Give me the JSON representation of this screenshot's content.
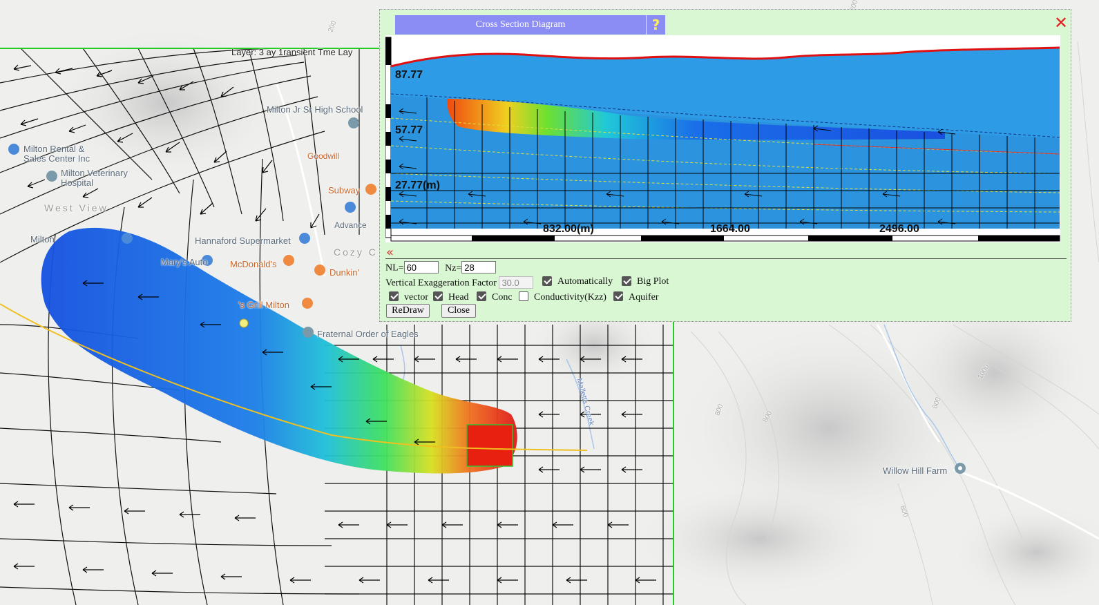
{
  "map": {
    "places": [
      {
        "name": "Milton Rental & Sales Center Inc",
        "line1": "Milton Rental &",
        "line2": "Sales Center Inc"
      },
      {
        "name": "Milton Veterinary Hospital",
        "line1": "Milton Veterinary",
        "line2": "Hospital"
      },
      {
        "name": "Milton Jr Sr High School",
        "line1": "Milton Jr Sr High School"
      },
      {
        "name": "West View",
        "line1": "West View"
      },
      {
        "name": "Milton",
        "line1": "Milton"
      },
      {
        "name": "Hannaford Supermarket",
        "line1": "Hannaford Supermarket"
      },
      {
        "name": "Mary's Auto",
        "line1": "Mary's Auto"
      },
      {
        "name": "McDonald's",
        "line1": "McDonald's"
      },
      {
        "name": "Subway",
        "line1": "Subway"
      },
      {
        "name": "Dunkin'",
        "line1": "Dunkin'"
      },
      {
        "name": "Cozy Corner",
        "line1": "Cozy C"
      },
      {
        "name": "'s Grill Milton",
        "line1": "'s Grill Milton"
      },
      {
        "name": "Fraternal Order of Eagles",
        "line1": "Fraternal Order of Eagles"
      },
      {
        "name": "Willow Hill Farm",
        "line1": "Willow Hill Farm"
      },
      {
        "name": "Malletts Creek",
        "line1": "Malletts Creek"
      },
      {
        "name": "Advance",
        "line1": "Advance"
      },
      {
        "name": "Goodwill",
        "line1": "Goodwill"
      }
    ],
    "contours": [
      "800",
      "800",
      "800",
      "1000",
      "800",
      "200",
      "200"
    ],
    "overlay_title": "Layer: 3 ay 1ransient Tme Lay"
  },
  "dialog": {
    "title": "Cross Section Diagram",
    "help": "?",
    "close": "✕",
    "collapse": "«",
    "nl_label": "NL=",
    "nl_value": "60",
    "nz_label": "Nz=",
    "nz_value": "28",
    "vef_label": "Vertical Exaggeration Factor",
    "vef_value": "30.0",
    "auto_label": "Automatically",
    "bigplot_label": "Big Plot",
    "vector_label": "vector",
    "head_label": "Head",
    "conc_label": "Conc",
    "kzz_label": "Conductivity(Kzz)",
    "aquifer_label": "Aquifer",
    "redraw_label": "ReDraw",
    "close_label": "Close",
    "checks": {
      "auto": true,
      "bigplot": true,
      "vector": true,
      "head": true,
      "conc": true,
      "kzz": false,
      "aquifer": true
    }
  },
  "cross_section": {
    "y_labels": [
      "87.77",
      "57.77",
      "27.77(m)"
    ],
    "x_labels": [
      "832.00(m)",
      "1664.00",
      "2496.00"
    ],
    "colors": {
      "water": "#2e9be6",
      "surface": "#e01010",
      "plume_hot": "#e03a10",
      "plume_mid": "#7ee020",
      "plume_low": "#1060e0"
    }
  }
}
